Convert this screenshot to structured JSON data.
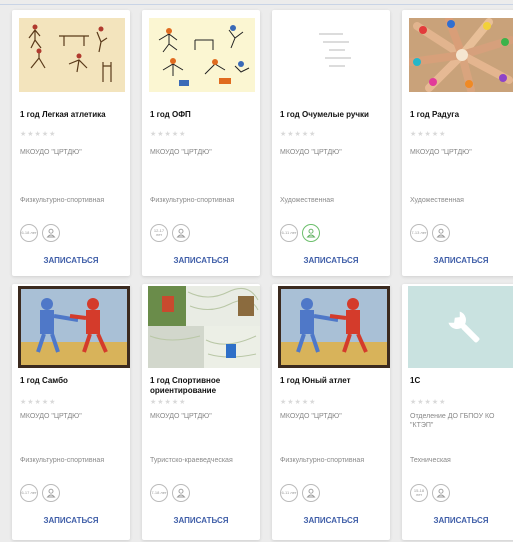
{
  "cards": [
    {
      "title": "1 год Легкая атлетика",
      "org": "МКОУДО \"ЦРТДЮ\"",
      "direction": "Физкультурно-спортивная",
      "age": "6-18 лет",
      "enroll": "ЗАПИСАТЬСЯ",
      "image": "athletics-drawing"
    },
    {
      "title": "1 год ОФП",
      "org": "МКОУДО \"ЦРТДЮ\"",
      "direction": "Физкультурно-спортивная",
      "age": "12-17 лет",
      "enroll": "ЗАПИСАТЬСЯ",
      "image": "sports-figures-drawing"
    },
    {
      "title": "1 год Очумелые ручки",
      "org": "МКОУДО \"ЦРТДЮ\"",
      "direction": "Художественная",
      "age": "6-11 лет",
      "enroll": "ЗАПИСАТЬСЯ",
      "image": "placeholder-lines"
    },
    {
      "title": "1 год Радуга",
      "org": "МКОУДО \"ЦРТДЮ\"",
      "direction": "Художественная",
      "age": "7-13 лет",
      "enroll": "ЗАПИСАТЬСЯ",
      "image": "painted-hands-photo"
    },
    {
      "title": "1 год Самбо",
      "org": "МКОУДО \"ЦРТДЮ\"",
      "direction": "Физкультурно-спортивная",
      "age": "6-17 лет",
      "enroll": "ЗАПИСАТЬСЯ",
      "image": "wrestlers-drawing"
    },
    {
      "title": "1 год Спортивное ориентирование",
      "org": "МКОУДО \"ЦРТДЮ\"",
      "direction": "Туристско-краеведческая",
      "age": "7-18 лет",
      "enroll": "ЗАПИСАТЬСЯ",
      "image": "orienteering-collage"
    },
    {
      "title": "1 год Юный атлет",
      "org": "МКОУДО \"ЦРТДЮ\"",
      "direction": "Физкультурно-спортивная",
      "age": "6-11 лет",
      "enroll": "ЗАПИСАТЬСЯ",
      "image": "wrestlers-drawing"
    },
    {
      "title": "1С",
      "org": "Отделение ДО ГБПОУ КО \"КТЭП\"",
      "direction": "Техническая",
      "age": "15-18 лет",
      "enroll": "ЗАПИСАТЬСЯ",
      "image": "wrench-icon"
    }
  ],
  "stars_text": "★★★★★",
  "colors": {
    "accent": "#3f5ea8",
    "wrench_bg": "#c9e2e0"
  }
}
